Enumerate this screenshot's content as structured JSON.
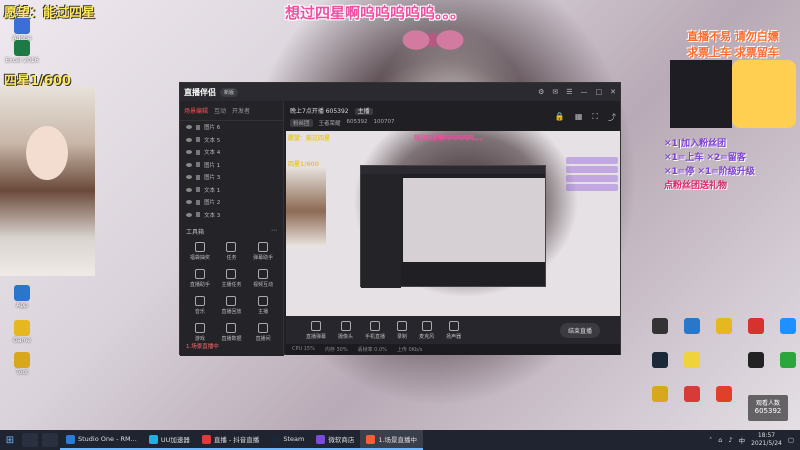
{
  "overlay": {
    "title": "想过四星啊呜呜呜呜呜。。。",
    "wish": "愿望：能过四星",
    "goal": "四星1/600"
  },
  "promo": {
    "line1": "直播不易 请勿白嫖",
    "line2": "求票上车 求票留车"
  },
  "gifts": [
    "✕1|加入粉丝团",
    "✕1=上车 ✕2=留客",
    "✕1=停 ✕1=阶级升级",
    "点粉丝团送礼物"
  ],
  "desktop_left": [
    {
      "label": "Adobe",
      "color": "#3a6fd8"
    },
    {
      "label": "Excel 2016",
      "color": "#1e7a44"
    },
    {
      "label": "App",
      "color": "#2a77c9"
    },
    {
      "label": "Game",
      "color": "#e6b820"
    },
    {
      "label": "Tool",
      "color": "#d8a81c"
    }
  ],
  "app": {
    "brand": "直播伴侣",
    "version": "新版",
    "side_tabs": [
      "场景编辑",
      "互动",
      "开发者"
    ],
    "layers": [
      {
        "name": "图片 6"
      },
      {
        "name": "文本 5"
      },
      {
        "name": "文本 4"
      },
      {
        "name": "图片 1"
      },
      {
        "name": "图片 3"
      },
      {
        "name": "文本 1"
      },
      {
        "name": "图片 2"
      },
      {
        "name": "文本 3"
      }
    ],
    "tools_title": "工具箱",
    "tools": [
      {
        "label": "福袋抽奖"
      },
      {
        "label": "任务"
      },
      {
        "label": "弹幕助手"
      },
      {
        "label": "直播助手"
      },
      {
        "label": "主播任务"
      },
      {
        "label": "视频互动"
      },
      {
        "label": "音乐"
      },
      {
        "label": "直播回放"
      },
      {
        "label": "主播"
      },
      {
        "label": "游戏"
      },
      {
        "label": "直播数据"
      },
      {
        "label": "直播间"
      }
    ],
    "scene_btn": "1.场景直播中",
    "stream": {
      "title": "晚上7点开播 605392",
      "badge": "主播",
      "fans": "100707",
      "meta": [
        "粉丝团",
        "王者荣耀",
        "605392"
      ]
    },
    "preview": {
      "title": "想过四星啊呜呜呜呜呜。。。",
      "wish": "愿望：能过四星",
      "goal": "四星1/600"
    },
    "bottom_tools": [
      {
        "label": "直播弹幕"
      },
      {
        "label": "摄像头"
      },
      {
        "label": "手机直播"
      },
      {
        "label": "录制"
      },
      {
        "label": "麦克风"
      },
      {
        "label": "扬声器"
      }
    ],
    "go_live": "结束直播",
    "status": [
      "CPU 15%",
      "内存 30%",
      "丢帧率 0.0%",
      "上传 0Kb/s"
    ]
  },
  "viewers": {
    "label": "观看人数",
    "count": "605392"
  },
  "taskbar": {
    "apps": [
      {
        "label": "Studio One - RM...",
        "color": "#2d7bd6"
      },
      {
        "label": "UU加速器",
        "color": "#1bb3e0"
      },
      {
        "label": "直播 - 抖音直播",
        "color": "#e03a3a"
      },
      {
        "label": "Steam",
        "color": "#1b2838"
      },
      {
        "label": "微软商店",
        "color": "#7b4ad8"
      },
      {
        "label": "1.场景直播中",
        "color": "#ff5b3a"
      }
    ],
    "time": "18:57",
    "date": "2021/5/24",
    "ime": "中"
  },
  "colors": {
    "accent": "#ff4e4e",
    "overlay_pink": "#f24ea3",
    "overlay_yellow": "#ffe95a",
    "taskbar": "#1f2430"
  }
}
